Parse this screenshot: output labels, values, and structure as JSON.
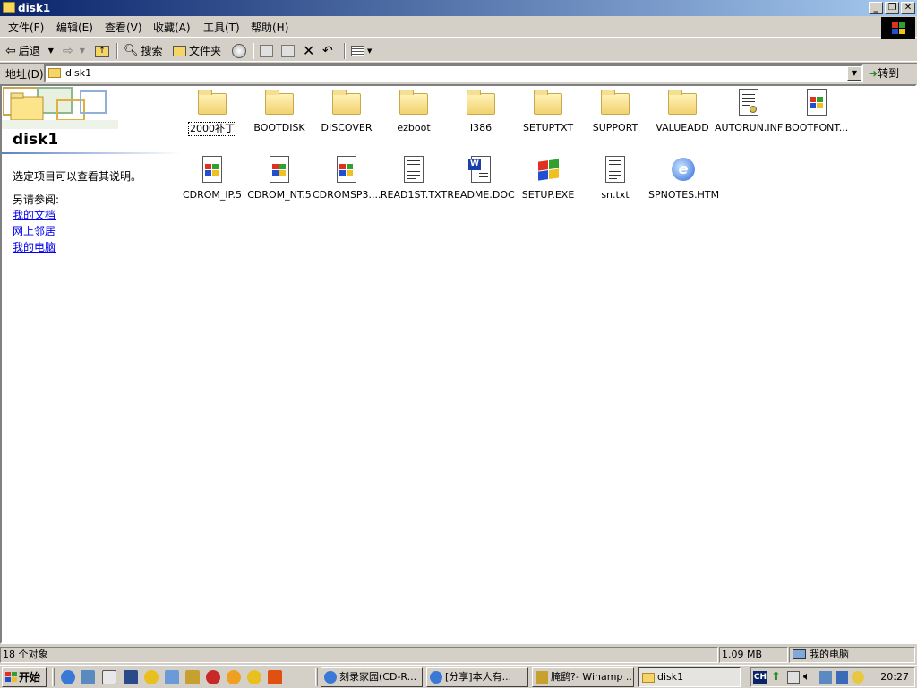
{
  "window": {
    "title": "disk1"
  },
  "menu": [
    "文件(F)",
    "编辑(E)",
    "查看(V)",
    "收藏(A)",
    "工具(T)",
    "帮助(H)"
  ],
  "toolbar": {
    "back": "后退",
    "search": "搜索",
    "folders": "文件夹"
  },
  "address": {
    "label": "地址(D)",
    "value": "disk1",
    "go": "转到"
  },
  "left_pane": {
    "title": "disk1",
    "description": "选定项目可以查看其说明。",
    "see_also": "另请参阅:",
    "links": [
      "我的文档",
      "网上邻居",
      "我的电脑"
    ]
  },
  "files": [
    {
      "name": "2000补丁",
      "type": "folder"
    },
    {
      "name": "BOOTDISK",
      "type": "folder"
    },
    {
      "name": "DISCOVER",
      "type": "folder"
    },
    {
      "name": "ezboot",
      "type": "folder"
    },
    {
      "name": "I386",
      "type": "folder"
    },
    {
      "name": "SETUPTXT",
      "type": "folder"
    },
    {
      "name": "SUPPORT",
      "type": "folder"
    },
    {
      "name": "VALUEADD",
      "type": "folder"
    },
    {
      "name": "AUTORUN.INF",
      "type": "settings"
    },
    {
      "name": "BOOTFONT...",
      "type": "system"
    },
    {
      "name": "CDROM_IP.5",
      "type": "system"
    },
    {
      "name": "CDROM_NT.5",
      "type": "system"
    },
    {
      "name": "CDROMSP3....",
      "type": "system"
    },
    {
      "name": "READ1ST.TXT",
      "type": "text"
    },
    {
      "name": "README.DOC",
      "type": "word"
    },
    {
      "name": "SETUP.EXE",
      "type": "exe"
    },
    {
      "name": "sn.txt",
      "type": "text"
    },
    {
      "name": "SPNOTES.HTM",
      "type": "html"
    }
  ],
  "status": {
    "objects": "18 个对象",
    "size": "1.09 MB",
    "location": "我的电脑"
  },
  "taskbar": {
    "start": "开始",
    "tasks": [
      "刻录家园(CD-R...",
      "[分享]本人有...",
      "腌鹞?- Winamp ...",
      "disk1"
    ],
    "tray_lang": "CH",
    "clock": "20:27"
  },
  "colors": {
    "title_start": "#0a246a",
    "title_end": "#a6caf0",
    "face": "#d4d0c8",
    "link": "#0000ee"
  }
}
